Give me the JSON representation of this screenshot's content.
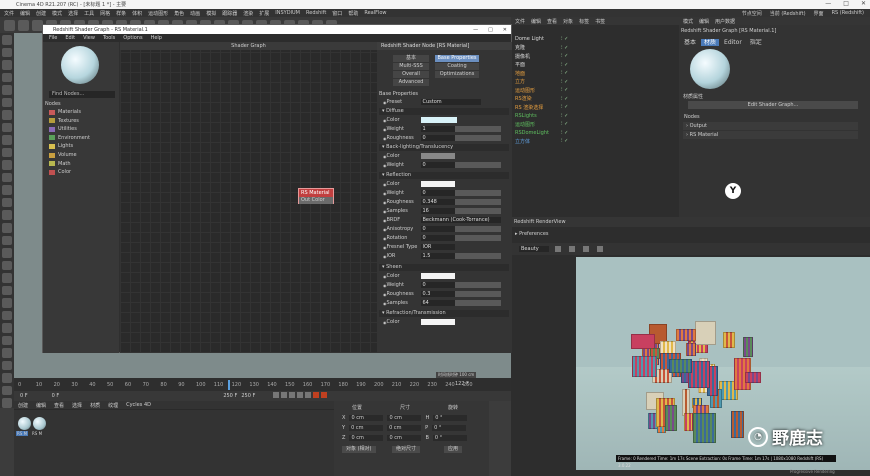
{
  "app": {
    "title": "Cinema 4D R21.207 (RC) - [未标题 1 *] - 主要",
    "window_controls": [
      "—",
      "□",
      "✕"
    ]
  },
  "menu": {
    "left": [
      "文件",
      "编辑",
      "创建",
      "模式",
      "选择",
      "工具",
      "网格",
      "样条",
      "体积",
      "运动图形",
      "角色",
      "动画",
      "模拟",
      "跟踪器",
      "渲染",
      "扩展",
      "INSYDIUM",
      "Redshift",
      "窗口",
      "帮助",
      "RealFlow"
    ],
    "right": [
      "节点空间",
      "当前 (Redshift)",
      "界面",
      "RS (Redshift)"
    ]
  },
  "timeline": {
    "ticks": [
      "0",
      "10",
      "20",
      "30",
      "40",
      "50",
      "60",
      "70",
      "80",
      "90",
      "100",
      "110",
      "120",
      "130",
      "140",
      "150",
      "160",
      "170",
      "180",
      "190",
      "200",
      "210",
      "220",
      "230",
      "240",
      "250"
    ],
    "end_frame": "122 F",
    "time_label": "时间线时钟",
    "time_value": "100 cm"
  },
  "transport": {
    "current": "0 F",
    "start": "0 F",
    "end": "250 F",
    "end2": "250 F"
  },
  "matmgr": {
    "menu": [
      "创建",
      "编辑",
      "查看",
      "选择",
      "材质",
      "纹理",
      "Cycles 4D"
    ],
    "materials": [
      "RS M",
      "RS M"
    ]
  },
  "coords": {
    "headers": [
      "位置",
      "尺寸",
      "旋转"
    ],
    "rows": [
      {
        "axis": "X",
        "pos": "0 cm",
        "size": "0 cm",
        "rot_axis": "H",
        "rot": "0 °"
      },
      {
        "axis": "Y",
        "pos": "0 cm",
        "size": "0 cm",
        "rot_axis": "P",
        "rot": "0 °"
      },
      {
        "axis": "Z",
        "pos": "0 cm",
        "size": "0 cm",
        "rot_axis": "B",
        "rot": "0 °"
      }
    ],
    "mode1": "对象 (相对)",
    "mode2": "绝对尺寸",
    "apply": "应用"
  },
  "objmgr": {
    "tabs": [
      "文件",
      "编辑",
      "查看",
      "对象",
      "标签",
      "书签"
    ],
    "items": [
      "Dome Light",
      "克隆",
      "摄像机",
      "平面",
      "地面",
      "立方",
      "运动图形",
      "RS渲染",
      "RS 渲染选择",
      "RSLights",
      "运动图形",
      "RSDomeLight",
      "立方体"
    ]
  },
  "attr": {
    "tabs": [
      "模式",
      "编辑",
      "用户数据"
    ],
    "title": "Redshift Shader Graph [RS Material.1]",
    "subtabs": [
      "基本",
      "材质",
      "Editor",
      "指定"
    ],
    "section": "材质属性",
    "button": "Edit Shader Graph...",
    "nodes_label": "Nodes",
    "output": "Output",
    "rs_material": "RS Material"
  },
  "rv": {
    "title": "Redshift RenderView",
    "prefs": "Preferences",
    "beauty": "Beauty",
    "caption": "Frame: 0   Rendered Time: 1m 17s   Scene Extraction: 0s   Frame Time: 1m 17s  | 1080x1080  Redshift (RS) 3.0.22"
  },
  "status": {
    "right": "Progressive Rendering"
  },
  "watermark": {
    "text": "野鹿志"
  },
  "sg": {
    "title": "Redshift Shader Graph - RS Material.1",
    "menu": [
      "File",
      "Edit",
      "View",
      "Tools",
      "Options",
      "Help"
    ],
    "find": "Find Nodes...",
    "nodes_label": "Nodes",
    "library": [
      {
        "name": "Materials",
        "color": "#c95a5a"
      },
      {
        "name": "Textures",
        "color": "#b59d3c"
      },
      {
        "name": "Utilities",
        "color": "#8a6ab8"
      },
      {
        "name": "Environment",
        "color": "#5aa05a"
      },
      {
        "name": "Lights",
        "color": "#d8c050"
      },
      {
        "name": "Volume",
        "color": "#c9a040"
      },
      {
        "name": "Math",
        "color": "#b8b850"
      },
      {
        "name": "Color",
        "color": "#c05050"
      }
    ],
    "canvas_title": "Shader Graph",
    "node_title": "RS Material",
    "node_port": "Out Color",
    "panel": {
      "title": "Redshift Shader Node [RS Material]",
      "tabs_row1": [
        "基本",
        "Base Properties"
      ],
      "tabs_row2": [
        "Multi-SSS",
        "Coating"
      ],
      "tabs_row3": [
        "Overall",
        "Optimizations"
      ],
      "tab_advanced": "Advanced",
      "base_props": "Base Properties",
      "preset_label": "Preset",
      "preset_value": "Custom",
      "diffuse": "Diffuse",
      "color_label": "Color",
      "weight_label": "Weight",
      "weight_val": "1",
      "rough_label": "Roughness",
      "rough_val": "0",
      "backlight": "Back-lighting/Translucency",
      "bl_color": "Color",
      "bl_weight": "Weight",
      "bl_weight_val": "0",
      "reflection": "Reflection",
      "r_color": "Color",
      "r_weight": "Weight",
      "r_weight_val": "0",
      "r_rough": "Roughness",
      "r_rough_val": "0.348",
      "r_samples": "Samples",
      "r_samples_val": "16",
      "brdf_label": "BRDF",
      "brdf_val": "Beckmann (Cook-Torrance)",
      "aniso": "Anisotropy",
      "aniso_val": "0",
      "rotation": "Rotation",
      "rotation_val": "0",
      "fresnel": "Fresnel Type",
      "fresnel_val": "IOR",
      "ior": "IOR",
      "ior_val": "1.5",
      "sheen": "Sheen",
      "s_color": "Color",
      "s_weight": "Weight",
      "s_weight_val": "0",
      "s_rough": "Roughness",
      "s_rough_val": "0.3",
      "s_samples": "Samples",
      "s_samples_val": "64",
      "refraction": "Refraction/Transmission",
      "rf_color": "Color"
    }
  }
}
